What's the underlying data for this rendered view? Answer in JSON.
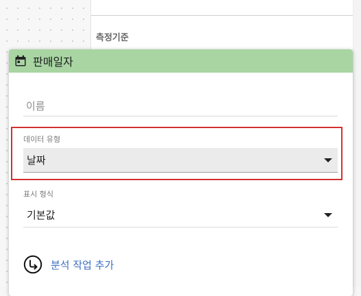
{
  "background": {
    "section_label": "측정기준"
  },
  "card": {
    "title": "판매일자",
    "header_color": "#a8d5a2",
    "icon": "calendar-icon",
    "name_field": {
      "placeholder": "이름",
      "value": ""
    },
    "data_type": {
      "label": "데이터 유형",
      "selected": "날짜"
    },
    "display_format": {
      "label": "표시 형식",
      "selected": "기본값"
    },
    "add_analysis": {
      "label": "분석 작업 추가",
      "icon": "arrow-return-circle-icon",
      "color": "#3b6fc2"
    }
  },
  "highlight_color": "#d32f2f"
}
